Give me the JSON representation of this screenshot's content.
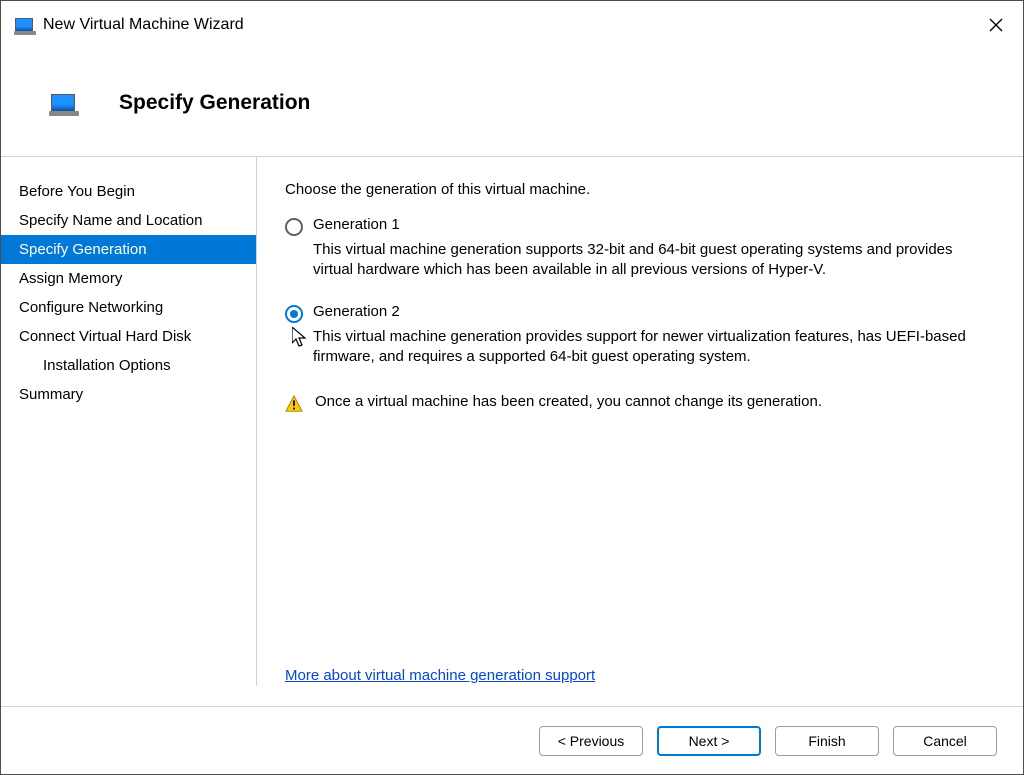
{
  "window": {
    "title": "New Virtual Machine Wizard"
  },
  "header": {
    "title": "Specify Generation"
  },
  "sidebar": {
    "items": [
      {
        "label": "Before You Begin"
      },
      {
        "label": "Specify Name and Location"
      },
      {
        "label": "Specify Generation"
      },
      {
        "label": "Assign Memory"
      },
      {
        "label": "Configure Networking"
      },
      {
        "label": "Connect Virtual Hard Disk"
      },
      {
        "label": "Installation Options"
      },
      {
        "label": "Summary"
      }
    ]
  },
  "content": {
    "prompt": "Choose the generation of this virtual machine.",
    "gen1_label": "Generation 1",
    "gen1_desc": "This virtual machine generation supports 32-bit and 64-bit guest operating systems and provides virtual hardware which has been available in all previous versions of Hyper-V.",
    "gen2_label": "Generation 2",
    "gen2_desc": "This virtual machine generation provides support for newer virtualization features, has UEFI-based firmware, and requires a supported 64-bit guest operating system.",
    "warning": "Once a virtual machine has been created, you cannot change its generation.",
    "more_link": "More about virtual machine generation support"
  },
  "footer": {
    "previous": "< Previous",
    "next": "Next >",
    "finish": "Finish",
    "cancel": "Cancel"
  }
}
